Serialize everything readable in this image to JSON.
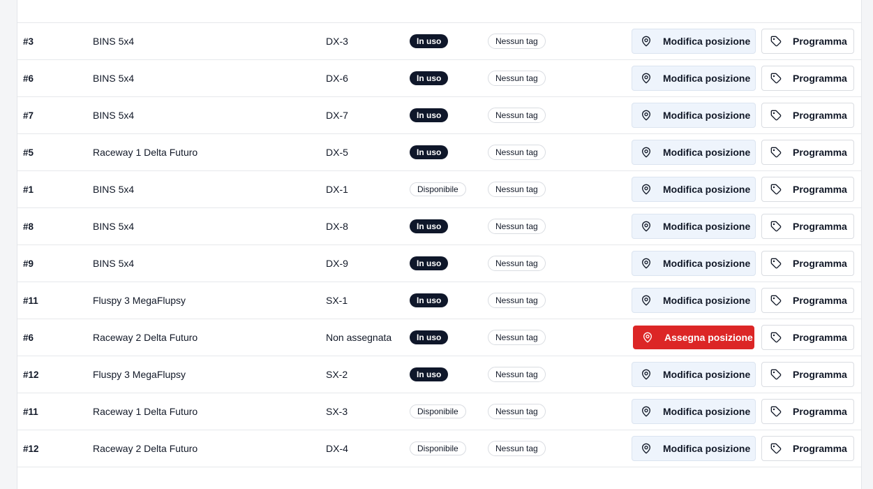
{
  "rows": [
    {
      "id": "#3",
      "name": "BINS 5x4",
      "position": "DX-3",
      "status": "In uso",
      "status_style": "dark",
      "tag": "Nessun tag",
      "action": "Modifica posizione",
      "action_style": "normal",
      "program": "Programma"
    },
    {
      "id": "#6",
      "name": "BINS 5x4",
      "position": "DX-6",
      "status": "In uso",
      "status_style": "dark",
      "tag": "Nessun tag",
      "action": "Modifica posizione",
      "action_style": "normal",
      "program": "Programma"
    },
    {
      "id": "#7",
      "name": "BINS 5x4",
      "position": "DX-7",
      "status": "In uso",
      "status_style": "dark",
      "tag": "Nessun tag",
      "action": "Modifica posizione",
      "action_style": "normal",
      "program": "Programma"
    },
    {
      "id": "#5",
      "name": "Raceway 1 Delta Futuro",
      "position": "DX-5",
      "status": "In uso",
      "status_style": "dark",
      "tag": "Nessun tag",
      "action": "Modifica posizione",
      "action_style": "normal",
      "program": "Programma"
    },
    {
      "id": "#1",
      "name": "BINS 5x4",
      "position": "DX-1",
      "status": "Disponibile",
      "status_style": "light",
      "tag": "Nessun tag",
      "action": "Modifica posizione",
      "action_style": "normal",
      "program": "Programma"
    },
    {
      "id": "#8",
      "name": "BINS 5x4",
      "position": "DX-8",
      "status": "In uso",
      "status_style": "dark",
      "tag": "Nessun tag",
      "action": "Modifica posizione",
      "action_style": "normal",
      "program": "Programma"
    },
    {
      "id": "#9",
      "name": "BINS 5x4",
      "position": "DX-9",
      "status": "In uso",
      "status_style": "dark",
      "tag": "Nessun tag",
      "action": "Modifica posizione",
      "action_style": "normal",
      "program": "Programma"
    },
    {
      "id": "#11",
      "name": "Fluspy 3 MegaFlupsy",
      "position": "SX-1",
      "status": "In uso",
      "status_style": "dark",
      "tag": "Nessun tag",
      "action": "Modifica posizione",
      "action_style": "normal",
      "program": "Programma"
    },
    {
      "id": "#6",
      "name": "Raceway 2 Delta Futuro",
      "position": "Non assegnata",
      "status": "In uso",
      "status_style": "dark",
      "tag": "Nessun tag",
      "action": "Assegna posizione",
      "action_style": "danger",
      "program": "Programma"
    },
    {
      "id": "#12",
      "name": "Fluspy 3 MegaFlupsy",
      "position": "SX-2",
      "status": "In uso",
      "status_style": "dark",
      "tag": "Nessun tag",
      "action": "Modifica posizione",
      "action_style": "normal",
      "program": "Programma"
    },
    {
      "id": "#11",
      "name": "Raceway 1 Delta Futuro",
      "position": "SX-3",
      "status": "Disponibile",
      "status_style": "light",
      "tag": "Nessun tag",
      "action": "Modifica posizione",
      "action_style": "normal",
      "program": "Programma"
    },
    {
      "id": "#12",
      "name": "Raceway 2 Delta Futuro",
      "position": "DX-4",
      "status": "Disponibile",
      "status_style": "light",
      "tag": "Nessun tag",
      "action": "Modifica posizione",
      "action_style": "normal",
      "program": "Programma"
    }
  ],
  "icons": {
    "position": "map-pin-icon",
    "program": "tag-icon"
  },
  "colors": {
    "status_dark": "#0f172a",
    "danger": "#dc2626",
    "action_bg": "#eef4fc"
  }
}
